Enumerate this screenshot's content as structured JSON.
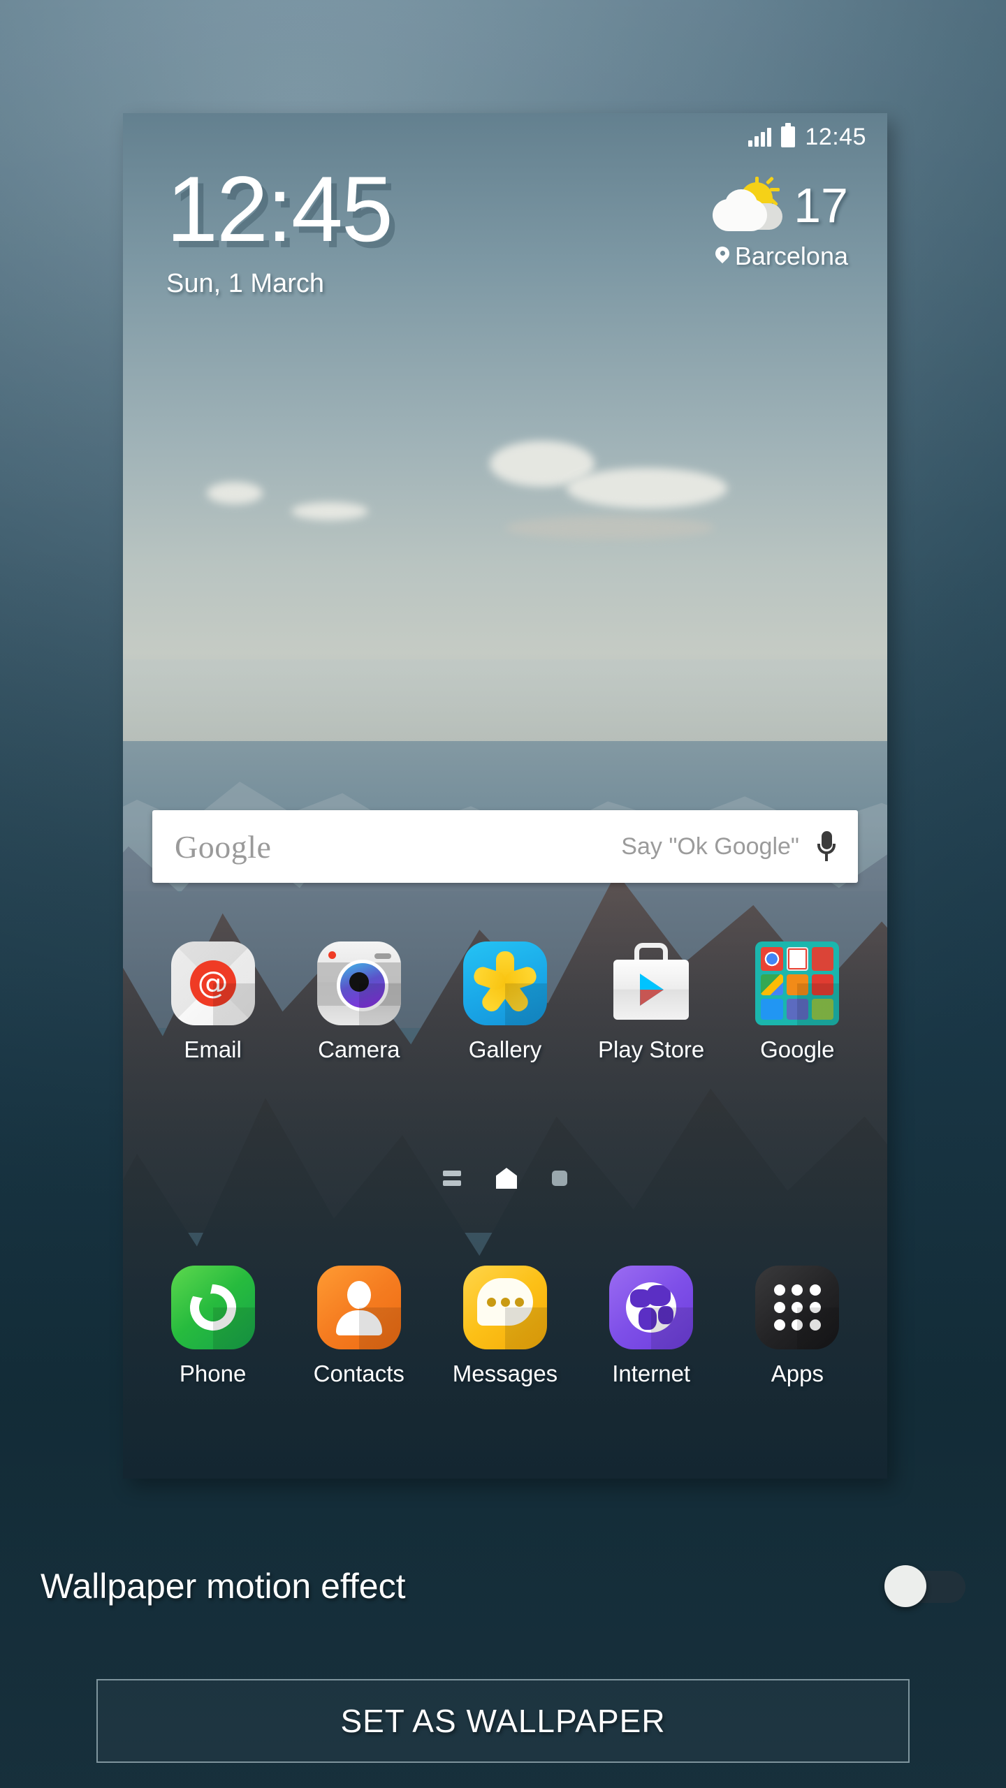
{
  "screen": {
    "title": "Wallpaper preview",
    "background_color": "#1f3a48"
  },
  "status_bar": {
    "clock": "12:45",
    "signal_icon": "signal-bars-icon",
    "battery_icon": "battery-icon"
  },
  "clock_widget": {
    "time": "12:45",
    "date": "Sun, 1 March"
  },
  "weather_widget": {
    "icon": "partly-cloudy-icon",
    "temperature": "17",
    "location_icon": "location-pin-icon",
    "location": "Barcelona"
  },
  "search_bar": {
    "logo": "Google",
    "hint": "Say \"Ok Google\"",
    "mic_icon": "microphone-icon"
  },
  "home_screen": {
    "apps": [
      {
        "label": "Email",
        "icon": "email-icon"
      },
      {
        "label": "Camera",
        "icon": "camera-icon"
      },
      {
        "label": "Gallery",
        "icon": "gallery-icon"
      },
      {
        "label": "Play Store",
        "icon": "play-store-icon"
      },
      {
        "label": "Google",
        "icon": "google-folder-icon"
      }
    ],
    "folder_apps": [
      "chrome-icon",
      "gmail-icon",
      "google-plus-icon",
      "maps-icon",
      "play-music-icon",
      "play-movies-icon",
      "play-books-icon",
      "news-icon",
      "play-games-icon"
    ],
    "page_indicators": [
      {
        "type": "briefing-page-icon",
        "active": false
      },
      {
        "type": "home-page-icon",
        "active": true
      },
      {
        "type": "extra-page-icon",
        "active": false
      }
    ],
    "dock": [
      {
        "label": "Phone",
        "icon": "phone-icon"
      },
      {
        "label": "Contacts",
        "icon": "contacts-icon"
      },
      {
        "label": "Messages",
        "icon": "messages-icon"
      },
      {
        "label": "Internet",
        "icon": "internet-icon"
      },
      {
        "label": "Apps",
        "icon": "apps-grid-icon"
      }
    ]
  },
  "controls": {
    "motion_effect_label": "Wallpaper motion effect",
    "motion_effect_state": "off",
    "set_wallpaper_label": "SET AS WALLPAPER"
  },
  "colors": {
    "accent_teal": "#1bb6ad",
    "panel_bg": "#5d7b8c",
    "bottom_bg": "#1f3a48",
    "button_border": "#7e949d"
  }
}
